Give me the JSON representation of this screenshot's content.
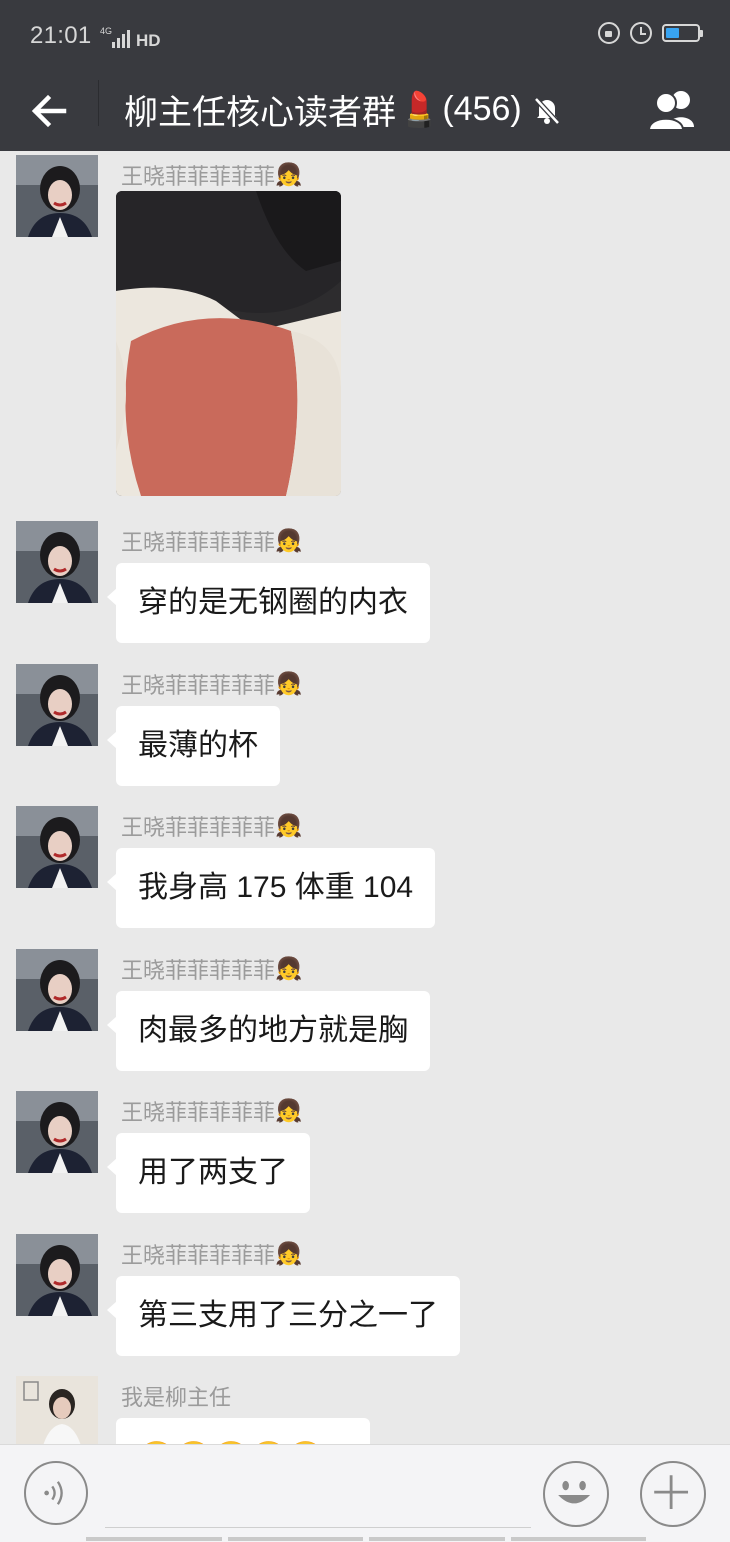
{
  "status_bar": {
    "time": "21:01",
    "network": "4G",
    "hd": "HD",
    "battery_level": 0.4,
    "icons": [
      "signal-icon",
      "lock-rotation-icon",
      "alarm-icon",
      "battery-icon"
    ]
  },
  "header": {
    "title": "柳主任核心读者群",
    "title_emoji": "💄",
    "member_count": "(456)",
    "icons": [
      "back-arrow-icon",
      "mute-bell-icon",
      "group-members-icon"
    ]
  },
  "messages": [
    {
      "sender": "王晓菲菲菲菲菲",
      "sender_emoji": "👧",
      "type": "image",
      "text": ""
    },
    {
      "sender": "王晓菲菲菲菲菲",
      "sender_emoji": "👧",
      "type": "text",
      "text": "穿的是无钢圈的内衣"
    },
    {
      "sender": "王晓菲菲菲菲菲",
      "sender_emoji": "👧",
      "type": "text",
      "text": "最薄的杯"
    },
    {
      "sender": "王晓菲菲菲菲菲",
      "sender_emoji": "👧",
      "type": "text",
      "text": "我身高 175 体重 104"
    },
    {
      "sender": "王晓菲菲菲菲菲",
      "sender_emoji": "👧",
      "type": "text",
      "text": "肉最多的地方就是胸"
    },
    {
      "sender": "王晓菲菲菲菲菲",
      "sender_emoji": "👧",
      "type": "text",
      "text": "用了两支了"
    },
    {
      "sender": "王晓菲菲菲菲菲",
      "sender_emoji": "👧",
      "type": "text",
      "text": "第三支用了三分之一了"
    },
    {
      "sender": "我是柳主任",
      "sender_emoji": "",
      "type": "text",
      "text": "😬😬😬😬😬"
    }
  ],
  "input_bar": {
    "value": "",
    "icons": [
      "voice-icon",
      "emoji-icon",
      "plus-icon"
    ]
  },
  "colors": {
    "header_bg": "#393a3f",
    "chat_bg": "#e9e9e9",
    "bubble_bg": "#ffffff",
    "nickname": "#9b9b9b"
  }
}
